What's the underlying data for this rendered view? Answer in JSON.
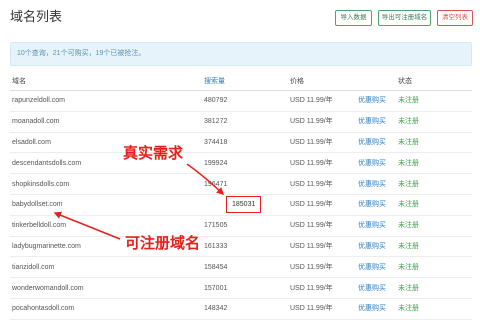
{
  "page": {
    "title": "域名列表"
  },
  "toolbar": {
    "import_label": "导入数据",
    "export_label": "导出可注册域名",
    "clear_label": "清空列表"
  },
  "summary": {
    "text": "10个查询，21个可购买，19个已被抢注。"
  },
  "table": {
    "headers": {
      "domain": "域名",
      "search_volume": "搜索量",
      "price": "价格",
      "status": "状态"
    },
    "rows": [
      {
        "domain": "rapunzeldoll.com",
        "search_volume": 480792,
        "price": "USD 11.99/年",
        "action": "优惠购买",
        "status": "未注册",
        "highlighted": false
      },
      {
        "domain": "moanadoll.com",
        "search_volume": 381272,
        "price": "USD 11.99/年",
        "action": "优惠购买",
        "status": "未注册",
        "highlighted": false
      },
      {
        "domain": "elsadoll.com",
        "search_volume": 374418,
        "price": "USD 11.99/年",
        "action": "优惠购买",
        "status": "未注册",
        "highlighted": false
      },
      {
        "domain": "descendantsdolls.com",
        "search_volume": 199924,
        "price": "USD 11.99/年",
        "action": "优惠购买",
        "status": "未注册",
        "highlighted": false
      },
      {
        "domain": "shopkinsdolls.com",
        "search_volume": 196471,
        "price": "USD 11.99/年",
        "action": "优惠购买",
        "status": "未注册",
        "highlighted": false
      },
      {
        "domain": "babydollset.com",
        "search_volume": 185031,
        "price": "USD 11.99/年",
        "action": "优惠购买",
        "status": "未注册",
        "highlighted": true
      },
      {
        "domain": "tinkerbelldoll.com",
        "search_volume": 171505,
        "price": "USD 11.99/年",
        "action": "优惠购买",
        "status": "未注册",
        "highlighted": false
      },
      {
        "domain": "ladybugmarinette.com",
        "search_volume": 161333,
        "price": "USD 11.99/年",
        "action": "优惠购买",
        "status": "未注册",
        "highlighted": false
      },
      {
        "domain": "tianzidoll.com",
        "search_volume": 158454,
        "price": "USD 11.99/年",
        "action": "优惠购买",
        "status": "未注册",
        "highlighted": false
      },
      {
        "domain": "wonderwomandoll.com",
        "search_volume": 157001,
        "price": "USD 11.99/年",
        "action": "优惠购买",
        "status": "未注册",
        "highlighted": false
      },
      {
        "domain": "pocahontasdoll.com",
        "search_volume": 148342,
        "price": "USD 11.99/年",
        "action": "优惠购买",
        "status": "未注册",
        "highlighted": false
      }
    ]
  },
  "annotations": {
    "real_demand_label": "真实需求",
    "registerable_label": "可注册域名"
  },
  "colors": {
    "link": "#2f80c0",
    "status_ok": "#3fa34d",
    "danger": "#d9534f",
    "annotation": "#e8201c",
    "info_background": "#e6f3fa",
    "info_text": "#5a93b5",
    "button_border": "#49a86b",
    "text": "#555555"
  }
}
